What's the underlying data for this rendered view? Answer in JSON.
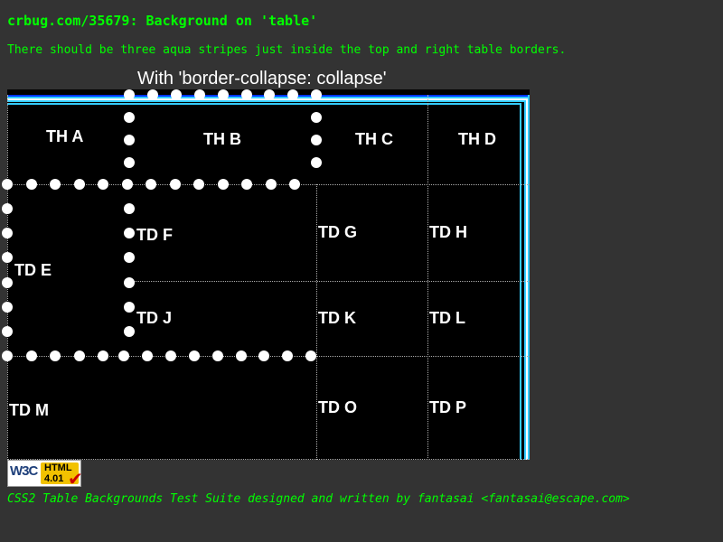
{
  "header": {
    "title": "crbug.com/35679: Background on 'table'",
    "note": "There should be three aqua stripes just inside the top and right table borders."
  },
  "table": {
    "caption": "With 'border-collapse: collapse'",
    "head_cells": [
      "TH A",
      "TH B",
      "TH C",
      "TH D"
    ],
    "body_cells": [
      "TD E",
      "TD F",
      "TD G",
      "TD H",
      "TD J",
      "TD K",
      "TD L",
      "TD M",
      "TD O",
      "TD P"
    ],
    "colors": {
      "table_bg": "#000000",
      "stripe": "#33ccff",
      "stripe_border": "#0033ff",
      "cell_text": "#ffffff"
    }
  },
  "badge": {
    "org": "W3C",
    "label": "HTML",
    "version": "4.01",
    "mark": "✔",
    "icon": "w3c-html401-valid-icon"
  },
  "footer": {
    "credit": "CSS2 Table Backgrounds Test Suite designed and written by fantasai <fantasai@escape.com>"
  }
}
